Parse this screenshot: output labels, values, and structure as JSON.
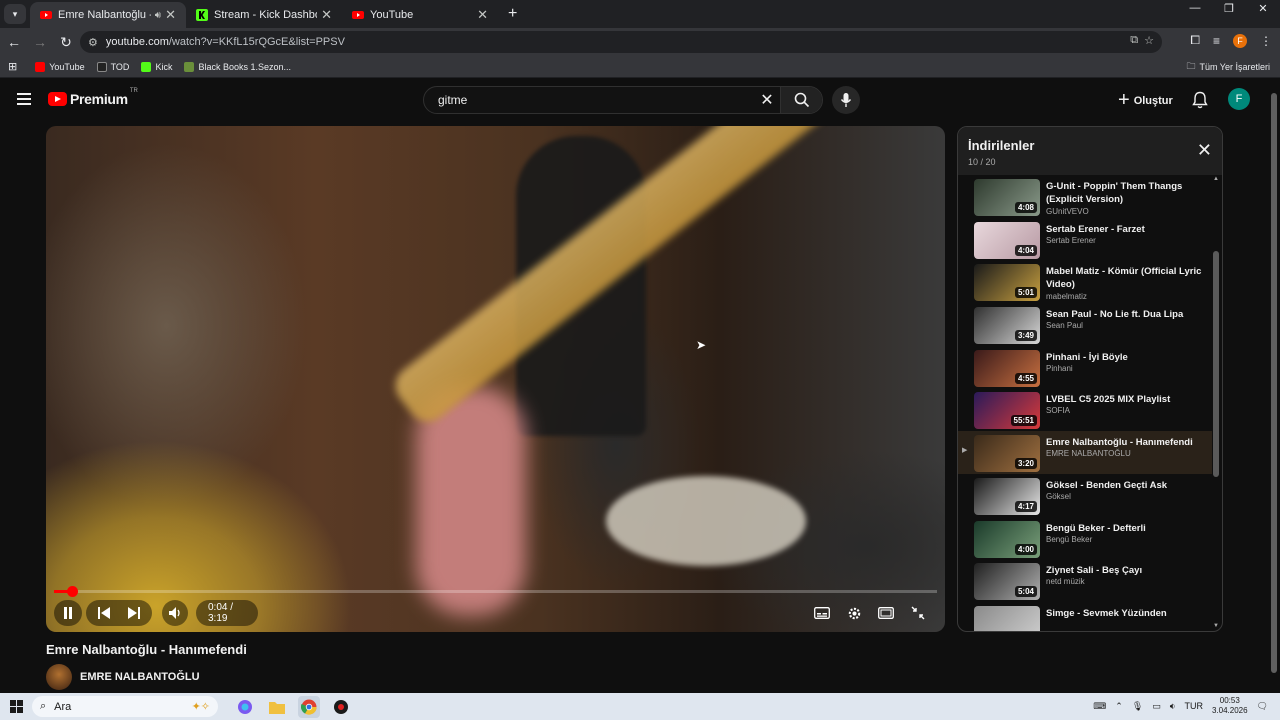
{
  "browser": {
    "tabs": [
      {
        "title": "Emre Nalbantoğlu - Hanımefendi",
        "favicon": "youtube-favicon",
        "audio": true,
        "active": true
      },
      {
        "title": "Stream - Kick Dashboard",
        "favicon": "kick-favicon",
        "active": false
      },
      {
        "title": "YouTube",
        "favicon": "youtube-favicon",
        "active": false
      }
    ],
    "url_host": "youtube.com",
    "url_path": "/watch?v=KKfL15rQGcE&list=PPSV",
    "bookmarks": [
      {
        "label": "YouTube",
        "color": "#ff0000"
      },
      {
        "label": "TOD",
        "color": "#222222"
      },
      {
        "label": "Kick",
        "color": "#53fc18"
      },
      {
        "label": "Black Books 1.Sezon...",
        "color": "#6a8f3a"
      }
    ],
    "all_bookmarks": "Tüm Yer İşaretleri",
    "profile_initial": "F"
  },
  "header": {
    "logo_word": "Premium",
    "logo_region": "TR",
    "search_value": "gitme",
    "create_label": "Oluştur",
    "avatar_initial": "F"
  },
  "player": {
    "time_current": "0:04",
    "time_sep": "/",
    "time_total": "3:19",
    "progress": 0.02
  },
  "video": {
    "title": "Emre Nalbantoğlu - Hanımefendi",
    "channel": "EMRE NALBANTOĞLU"
  },
  "playlist": {
    "title": "İndirilenler",
    "count": "10 / 20",
    "items": [
      {
        "title": "G-Unit - Poppin' Them Thangs (Explicit Version)",
        "channel": "GUnitVEVO",
        "duration": "4:08",
        "thumb": [
          "#2e3a2e",
          "#8a9a8a"
        ],
        "active": false
      },
      {
        "title": "Sertab Erener - Farzet",
        "channel": "Sertab Erener",
        "duration": "4:04",
        "thumb": [
          "#e8d8dc",
          "#b89aa4"
        ],
        "active": false
      },
      {
        "title": "Mabel Matiz - Kömür (Official Lyric Video)",
        "channel": "mabelmatiz",
        "duration": "5:01",
        "thumb": [
          "#1a1a1a",
          "#c8a040"
        ],
        "active": false
      },
      {
        "title": "Sean Paul - No Lie ft. Dua Lipa",
        "channel": "Sean Paul",
        "duration": "3:49",
        "thumb": [
          "#303030",
          "#d8d8d8"
        ],
        "active": false
      },
      {
        "title": "Pinhani - İyi Böyle",
        "channel": "Pinhani",
        "duration": "4:55",
        "thumb": [
          "#3a1a1a",
          "#c87040"
        ],
        "active": false
      },
      {
        "title": "LVBEL C5 2025 MIX Playlist",
        "channel": "SOFIA",
        "duration": "55:51",
        "thumb": [
          "#2a1a5a",
          "#d83a3a"
        ],
        "active": false
      },
      {
        "title": "Emre Nalbantoğlu - Hanımefendi",
        "channel": "EMRE NALBANTOĞLU",
        "duration": "3:20",
        "thumb": [
          "#3a2a1a",
          "#a07040"
        ],
        "active": true
      },
      {
        "title": "Göksel - Benden Geçti Ask",
        "channel": "Göksel",
        "duration": "4:17",
        "thumb": [
          "#1a1a1a",
          "#e8e8e8"
        ],
        "active": false
      },
      {
        "title": "Bengü Beker - Defterli",
        "channel": "Bengü Beker",
        "duration": "4:00",
        "thumb": [
          "#1a3a2a",
          "#7aa07a"
        ],
        "active": false
      },
      {
        "title": "Ziynet Sali - Beş Çayı",
        "channel": "netd müzik",
        "duration": "5:04",
        "thumb": [
          "#202020",
          "#b0b0b0"
        ],
        "active": false
      },
      {
        "title": "Simge - Sevmek Yüzünden",
        "channel": "",
        "duration": "",
        "thumb": [
          "#8a8a8a",
          "#d0d0d0"
        ],
        "active": false
      }
    ]
  },
  "taskbar": {
    "search_placeholder": "Ara",
    "language": "TUR",
    "time": "00:53",
    "date": "3.04.2026"
  }
}
